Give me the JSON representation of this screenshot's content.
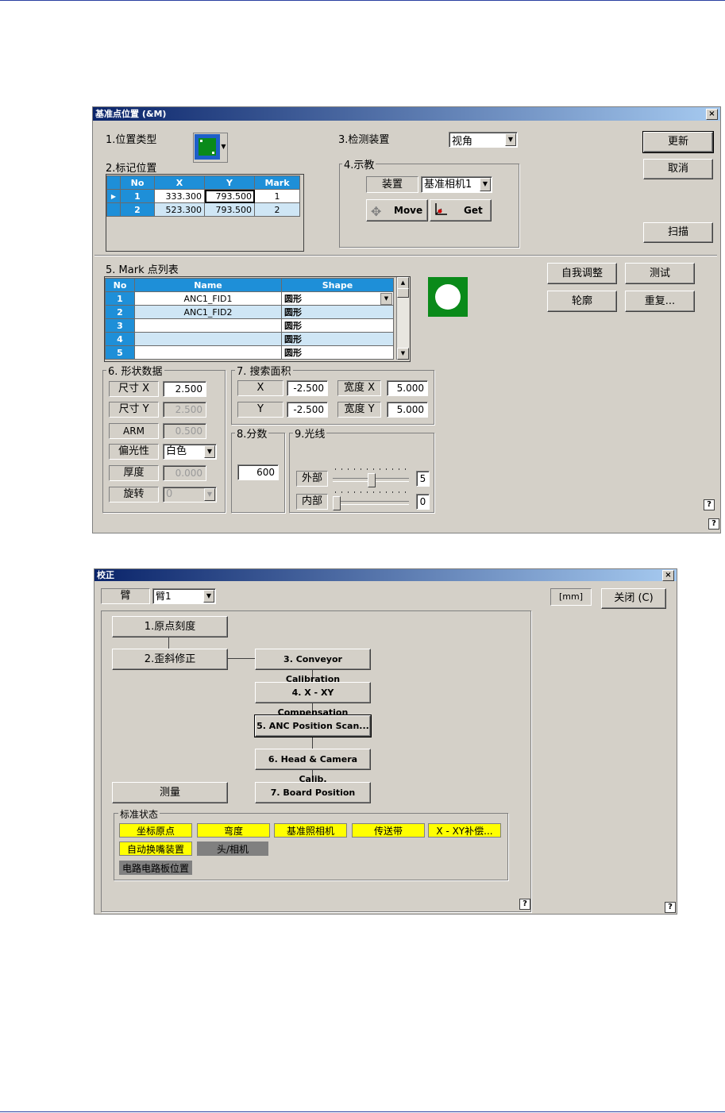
{
  "dialog1": {
    "title": "基准点位置 (&M)",
    "close_glyph": "×",
    "s1_label": "1.位置类型",
    "s2_label": "2.标记位置",
    "s3_label": "3.检测装置",
    "s3_value": "视角",
    "s4_label": "4.示教",
    "device_label": "装置",
    "device_value": "基准相机1",
    "move_label": "Move",
    "get_label": "Get",
    "buttons": {
      "update": "更新",
      "cancel": "取消",
      "scan": "扫描",
      "self_adjust": "自我调整",
      "test": "测试",
      "outline": "轮廓",
      "repeat": "重复..."
    },
    "marks_table": {
      "headers": [
        "No",
        "X",
        "Y",
        "Mark"
      ],
      "rows": [
        {
          "no": "1",
          "x": "333.300",
          "y": "793.500",
          "mark": "1"
        },
        {
          "no": "2",
          "x": "523.300",
          "y": "793.500",
          "mark": "2"
        }
      ]
    },
    "s5_label": "5. Mark 点列表",
    "mark_list": {
      "headers": [
        "No",
        "Name",
        "Shape"
      ],
      "rows": [
        {
          "no": "1",
          "name": "ANC1_FID1",
          "shape": "圆形"
        },
        {
          "no": "2",
          "name": "ANC1_FID2",
          "shape": "圆形"
        },
        {
          "no": "3",
          "name": "",
          "shape": "圆形"
        },
        {
          "no": "4",
          "name": "",
          "shape": "圆形"
        },
        {
          "no": "5",
          "name": "",
          "shape": "圆形"
        }
      ]
    },
    "s6_label": "6. 形状数据",
    "shape_data": {
      "size_x_label": "尺寸 X",
      "size_x": "2.500",
      "size_y_label": "尺寸 Y",
      "size_y": "2.500",
      "arm_label": "ARM",
      "arm": "0.500",
      "polarity_label": "偏光性",
      "polarity": "白色",
      "thickness_label": "厚度",
      "thickness": "0.000",
      "rotation_label": "旋转",
      "rotation": "0"
    },
    "s7_label": "7. 搜索面积",
    "search_area": {
      "x_label": "X",
      "x": "-2.500",
      "width_x_label": "宽度 X",
      "width_x": "5.000",
      "y_label": "Y",
      "y": "-2.500",
      "width_y_label": "宽度 Y",
      "width_y": "5.000"
    },
    "s8_label": "8.分数",
    "score": "600",
    "s9_label": "9.光线",
    "light": {
      "outer_label": "外部",
      "outer": "5",
      "outer_level": 5,
      "inner_label": "内部",
      "inner": "0",
      "inner_level": 0
    },
    "help": "?"
  },
  "dialog2": {
    "title": "校正",
    "close_glyph": "×",
    "arm_label": "臂",
    "arm_value": "臂1",
    "unit_label": "[mm]",
    "close_button": "关闭 (C)",
    "steps": {
      "s1": "1.原点刻度",
      "s2": "2.歪斜修正",
      "s3": "3. Conveyor Calibration",
      "s4": "4. X - XY Compensation",
      "s5": "5. ANC Position Scan...",
      "s6": "6. Head & Camera Calib.",
      "s7": "7. Board Position",
      "measure": "测量"
    },
    "status_label": "标准状态",
    "status": [
      {
        "label": "坐标原点",
        "color": "#ffff00"
      },
      {
        "label": "弯度",
        "color": "#ffff00"
      },
      {
        "label": "基准照相机",
        "color": "#ffff00"
      },
      {
        "label": "传送带",
        "color": "#ffff00"
      },
      {
        "label": "X - XY补偿...",
        "color": "#ffff00"
      },
      {
        "label": "自动换嘴装置",
        "color": "#ffff00"
      },
      {
        "label": "头/相机",
        "color": "#808080"
      },
      {
        "label": "电路电路板位置",
        "color": "#808080"
      }
    ],
    "help": "?"
  }
}
